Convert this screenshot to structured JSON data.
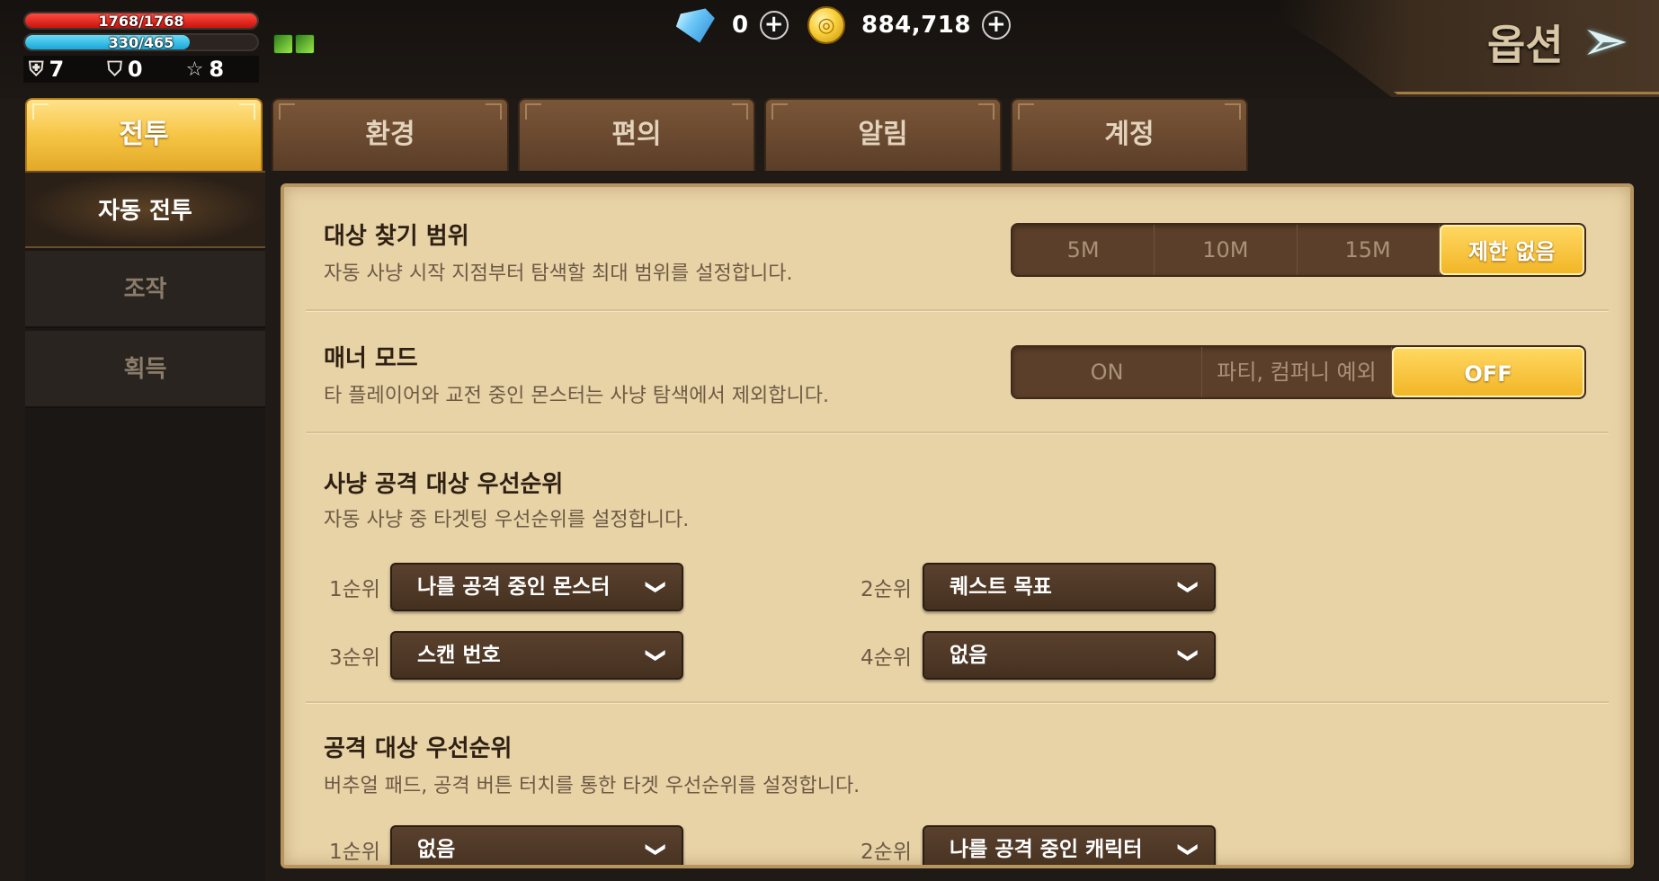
{
  "player": {
    "hp_text": "1768/1768",
    "hp_fraction": 1.0,
    "mp_text": "330/465",
    "mp_fraction": 0.71,
    "stats": [
      {
        "icon": "defense-icon",
        "value": "7"
      },
      {
        "icon": "shield-icon",
        "value": "0"
      },
      {
        "icon": "star-icon",
        "value": "8"
      }
    ]
  },
  "currency": {
    "diamond": "0",
    "gold": "884,718",
    "plus_symbol": "+"
  },
  "title": "옵션",
  "tabs": [
    {
      "label": "전투",
      "active": true
    },
    {
      "label": "환경",
      "active": false
    },
    {
      "label": "편의",
      "active": false
    },
    {
      "label": "알림",
      "active": false
    },
    {
      "label": "계정",
      "active": false
    }
  ],
  "sidebar": [
    {
      "label": "자동 전투",
      "active": true
    },
    {
      "label": "조작",
      "active": false
    },
    {
      "label": "획득",
      "active": false
    }
  ],
  "sections": {
    "search_range": {
      "title": "대상 찾기 범위",
      "desc": "자동 사냥 시작 지점부터 탐색할 최대 범위를 설정합니다.",
      "options": [
        "5M",
        "10M",
        "15M",
        "제한 없음"
      ],
      "selected": "제한 없음"
    },
    "manner_mode": {
      "title": "매너 모드",
      "desc": "타 플레이어와 교전 중인 몬스터는 사냥 탐색에서 제외합니다.",
      "options": [
        "ON",
        "파티, 컴퍼니 예외",
        "OFF"
      ],
      "selected": "OFF"
    },
    "hunt_priority": {
      "title": "사냥 공격 대상 우선순위",
      "desc": "자동 사냥 중 타겟팅 우선순위를 설정합니다.",
      "ranks": [
        {
          "label": "1순위",
          "value": "나를 공격 중인 몬스터"
        },
        {
          "label": "2순위",
          "value": "퀘스트 목표"
        },
        {
          "label": "3순위",
          "value": "스캔 번호"
        },
        {
          "label": "4순위",
          "value": "없음"
        }
      ]
    },
    "attack_priority": {
      "title": "공격 대상 우선순위",
      "desc": "버추얼 패드, 공격 버튼 터치를 통한 타겟 우선순위를 설정합니다.",
      "ranks": [
        {
          "label": "1순위",
          "value": "없음"
        },
        {
          "label": "2순위",
          "value": "나를 공격 중인 캐릭터"
        }
      ]
    }
  },
  "colors": {
    "accent_gold": "#f6c545",
    "panel_bg": "#e8d3a7",
    "hp_red": "#e0201a",
    "mp_blue": "#2bb5e0"
  }
}
